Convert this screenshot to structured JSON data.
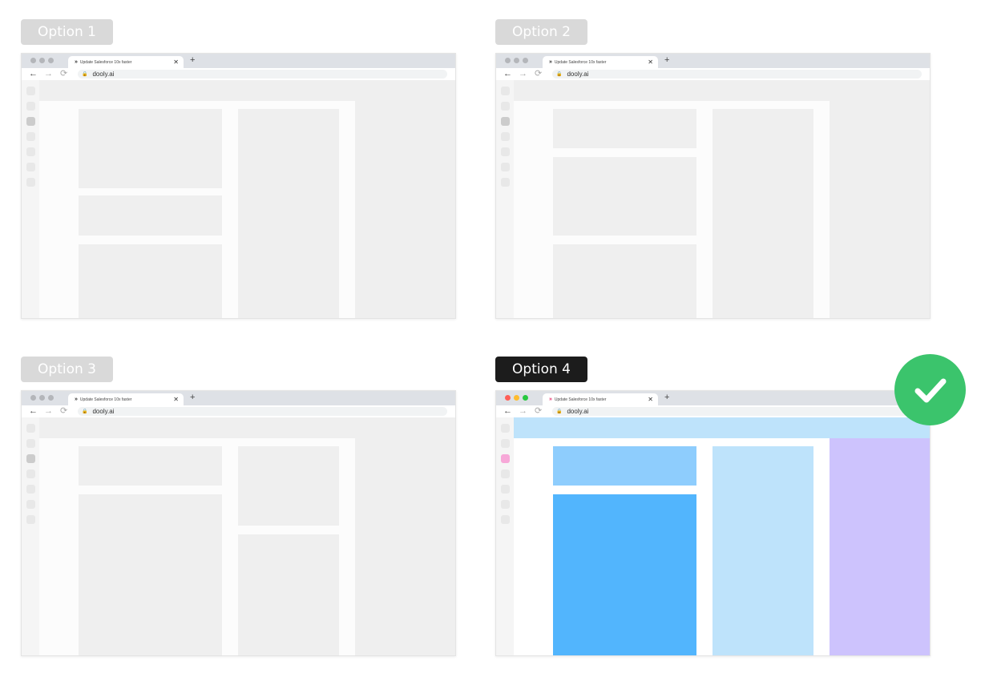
{
  "browser": {
    "tab_title": "Update Salesforce 10x faster",
    "tab_favicon": "dooly-logo-icon",
    "tab_close": "✕",
    "new_tab": "+",
    "url": "dooly.ai",
    "back": "←",
    "forward": "→",
    "reload": "⟳"
  },
  "options": [
    {
      "label": "Option 1",
      "selected": false
    },
    {
      "label": "Option 2",
      "selected": false
    },
    {
      "label": "Option 3",
      "selected": false
    },
    {
      "label": "Option 4",
      "selected": true
    }
  ],
  "selection_indicator": "checkmark-icon",
  "colors": {
    "selected_label_bg": "#1c1c1c",
    "unselected_label_bg": "#d9d9d9",
    "check_green": "#3bc46c",
    "top_strip": "#bee3fb",
    "block_light_blue": "#8ecdfd",
    "block_blue": "#52b5fd",
    "column_pale_blue": "#bee3fb",
    "side_panel_purple": "#cdc3fd",
    "rail_active_pink": "#f7a8d8"
  }
}
